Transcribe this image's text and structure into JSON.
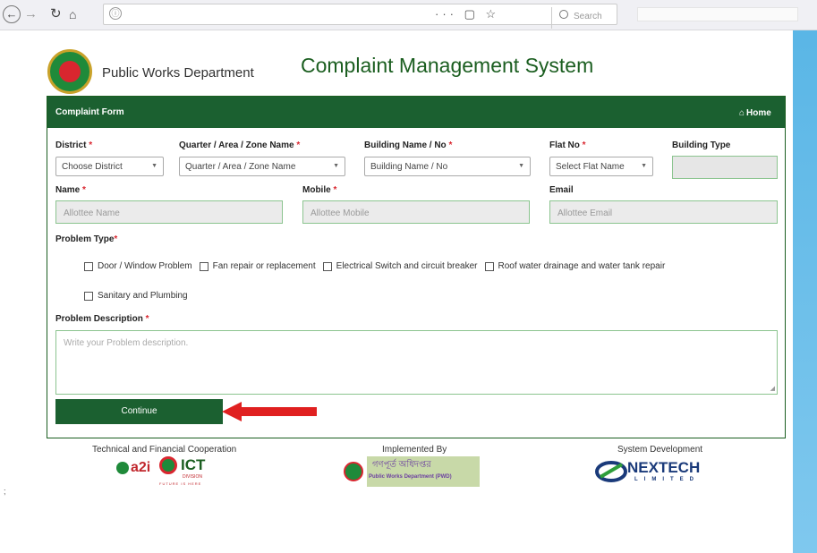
{
  "browser": {
    "back_icon": "back-arrow-icon",
    "forward_icon": "forward-arrow-icon",
    "reload_icon": "reload-icon",
    "home_icon": "home-icon",
    "url_info_glyph": "ⓘ",
    "url_actions": "··· ▢ ☆",
    "search_placeholder": "Search"
  },
  "header": {
    "department": "Public Works Department",
    "title": "Complaint Management System"
  },
  "panel": {
    "title": "Complaint Form",
    "home_link": "Home"
  },
  "labels": {
    "district": "District",
    "quarter": "Quarter / Area / Zone Name",
    "building": "Building Name / No",
    "flat": "Flat No",
    "building_type": "Building Type",
    "name": "Name",
    "mobile": "Mobile",
    "email": "Email",
    "problem_type": "Problem Type",
    "problem_description": "Problem Description",
    "required_mark": "*"
  },
  "selects": {
    "district": "Choose District",
    "quarter": "Quarter / Area / Zone Name",
    "building": "Building Name / No",
    "flat": "Select Flat Name"
  },
  "inputs": {
    "name_placeholder": "Allottee Name",
    "mobile_placeholder": "Allottee Mobile",
    "email_placeholder": "Allottee Email",
    "description_placeholder": "Write your Problem description."
  },
  "problem_types": [
    "Door / Window Problem",
    "Fan repair or replacement",
    "Electrical Switch and circuit breaker",
    "Roof water drainage and water tank repair",
    "Sanitary and Plumbing"
  ],
  "buttons": {
    "continue": "Continue"
  },
  "footer": {
    "cooperation": "Technical and Financial Cooperation",
    "implemented_by": "Implemented By",
    "system_development": "System Development",
    "a2i": "a2i",
    "ict": "ICT",
    "ict_division": "DIVISION",
    "ict_tagline": "FUTURE IS HERE",
    "pwd_bangla": "গণপূর্ত অধিদপ্তর",
    "pwd_english": "Public Works Department (PWD)",
    "nextech_name": "NEXTECH",
    "nextech_sub": "LIMITED"
  },
  "colors": {
    "brand_green": "#1b6030",
    "required_red": "#d9262f",
    "arrow_red": "#e02020"
  }
}
